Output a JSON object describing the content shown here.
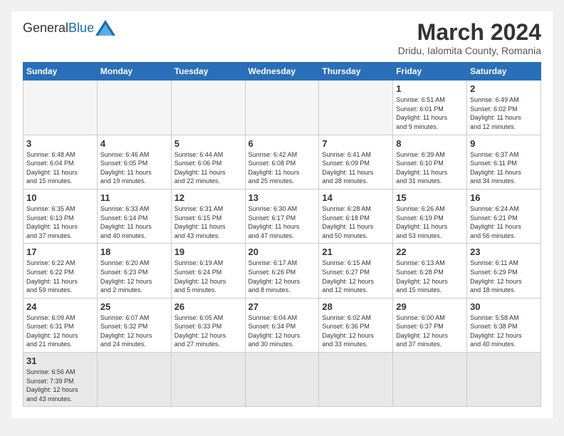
{
  "logo": {
    "text_general": "General",
    "text_blue": "Blue"
  },
  "header": {
    "month_year": "March 2024",
    "location": "Dridu, Ialomita County, Romania"
  },
  "weekdays": [
    "Sunday",
    "Monday",
    "Tuesday",
    "Wednesday",
    "Thursday",
    "Friday",
    "Saturday"
  ],
  "weeks": [
    [
      {
        "day": "",
        "info": ""
      },
      {
        "day": "",
        "info": ""
      },
      {
        "day": "",
        "info": ""
      },
      {
        "day": "",
        "info": ""
      },
      {
        "day": "",
        "info": ""
      },
      {
        "day": "1",
        "info": "Sunrise: 6:51 AM\nSunset: 6:01 PM\nDaylight: 11 hours\nand 9 minutes."
      },
      {
        "day": "2",
        "info": "Sunrise: 6:49 AM\nSunset: 6:02 PM\nDaylight: 11 hours\nand 12 minutes."
      }
    ],
    [
      {
        "day": "3",
        "info": "Sunrise: 6:48 AM\nSunset: 6:04 PM\nDaylight: 11 hours\nand 15 minutes."
      },
      {
        "day": "4",
        "info": "Sunrise: 6:46 AM\nSunset: 6:05 PM\nDaylight: 11 hours\nand 19 minutes."
      },
      {
        "day": "5",
        "info": "Sunrise: 6:44 AM\nSunset: 6:06 PM\nDaylight: 11 hours\nand 22 minutes."
      },
      {
        "day": "6",
        "info": "Sunrise: 6:42 AM\nSunset: 6:08 PM\nDaylight: 11 hours\nand 25 minutes."
      },
      {
        "day": "7",
        "info": "Sunrise: 6:41 AM\nSunset: 6:09 PM\nDaylight: 11 hours\nand 28 minutes."
      },
      {
        "day": "8",
        "info": "Sunrise: 6:39 AM\nSunset: 6:10 PM\nDaylight: 11 hours\nand 31 minutes."
      },
      {
        "day": "9",
        "info": "Sunrise: 6:37 AM\nSunset: 6:11 PM\nDaylight: 11 hours\nand 34 minutes."
      }
    ],
    [
      {
        "day": "10",
        "info": "Sunrise: 6:35 AM\nSunset: 6:13 PM\nDaylight: 11 hours\nand 37 minutes."
      },
      {
        "day": "11",
        "info": "Sunrise: 6:33 AM\nSunset: 6:14 PM\nDaylight: 11 hours\nand 40 minutes."
      },
      {
        "day": "12",
        "info": "Sunrise: 6:31 AM\nSunset: 6:15 PM\nDaylight: 11 hours\nand 43 minutes."
      },
      {
        "day": "13",
        "info": "Sunrise: 6:30 AM\nSunset: 6:17 PM\nDaylight: 11 hours\nand 47 minutes."
      },
      {
        "day": "14",
        "info": "Sunrise: 6:28 AM\nSunset: 6:18 PM\nDaylight: 11 hours\nand 50 minutes."
      },
      {
        "day": "15",
        "info": "Sunrise: 6:26 AM\nSunset: 6:19 PM\nDaylight: 11 hours\nand 53 minutes."
      },
      {
        "day": "16",
        "info": "Sunrise: 6:24 AM\nSunset: 6:21 PM\nDaylight: 11 hours\nand 56 minutes."
      }
    ],
    [
      {
        "day": "17",
        "info": "Sunrise: 6:22 AM\nSunset: 6:22 PM\nDaylight: 11 hours\nand 59 minutes."
      },
      {
        "day": "18",
        "info": "Sunrise: 6:20 AM\nSunset: 6:23 PM\nDaylight: 12 hours\nand 2 minutes."
      },
      {
        "day": "19",
        "info": "Sunrise: 6:19 AM\nSunset: 6:24 PM\nDaylight: 12 hours\nand 5 minutes."
      },
      {
        "day": "20",
        "info": "Sunrise: 6:17 AM\nSunset: 6:26 PM\nDaylight: 12 hours\nand 8 minutes."
      },
      {
        "day": "21",
        "info": "Sunrise: 6:15 AM\nSunset: 6:27 PM\nDaylight: 12 hours\nand 12 minutes."
      },
      {
        "day": "22",
        "info": "Sunrise: 6:13 AM\nSunset: 6:28 PM\nDaylight: 12 hours\nand 15 minutes."
      },
      {
        "day": "23",
        "info": "Sunrise: 6:11 AM\nSunset: 6:29 PM\nDaylight: 12 hours\nand 18 minutes."
      }
    ],
    [
      {
        "day": "24",
        "info": "Sunrise: 6:09 AM\nSunset: 6:31 PM\nDaylight: 12 hours\nand 21 minutes."
      },
      {
        "day": "25",
        "info": "Sunrise: 6:07 AM\nSunset: 6:32 PM\nDaylight: 12 hours\nand 24 minutes."
      },
      {
        "day": "26",
        "info": "Sunrise: 6:05 AM\nSunset: 6:33 PM\nDaylight: 12 hours\nand 27 minutes."
      },
      {
        "day": "27",
        "info": "Sunrise: 6:04 AM\nSunset: 6:34 PM\nDaylight: 12 hours\nand 30 minutes."
      },
      {
        "day": "28",
        "info": "Sunrise: 6:02 AM\nSunset: 6:36 PM\nDaylight: 12 hours\nand 33 minutes."
      },
      {
        "day": "29",
        "info": "Sunrise: 6:00 AM\nSunset: 6:37 PM\nDaylight: 12 hours\nand 37 minutes."
      },
      {
        "day": "30",
        "info": "Sunrise: 5:58 AM\nSunset: 6:38 PM\nDaylight: 12 hours\nand 40 minutes."
      }
    ],
    [
      {
        "day": "31",
        "info": "Sunrise: 6:56 AM\nSunset: 7:39 PM\nDaylight: 12 hours\nand 43 minutes."
      },
      {
        "day": "",
        "info": ""
      },
      {
        "day": "",
        "info": ""
      },
      {
        "day": "",
        "info": ""
      },
      {
        "day": "",
        "info": ""
      },
      {
        "day": "",
        "info": ""
      },
      {
        "day": "",
        "info": ""
      }
    ]
  ]
}
